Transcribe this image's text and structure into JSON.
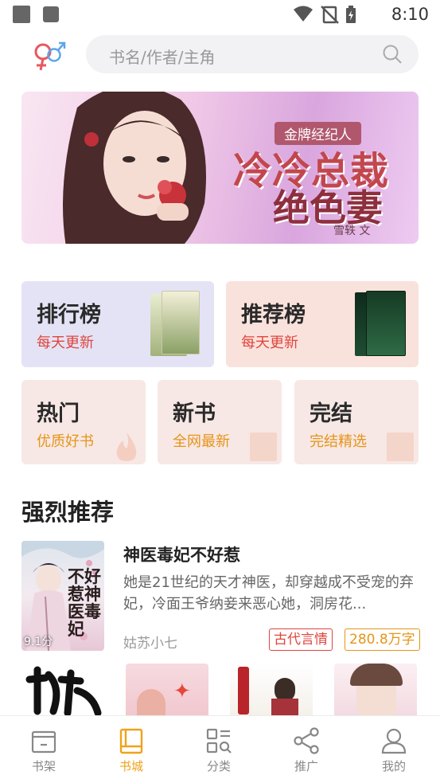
{
  "status_bar": {
    "time": "8:10"
  },
  "search": {
    "placeholder": "书名/作者/主角"
  },
  "banner": {
    "tag": "金牌经纪人",
    "title_line1": "冷冷总裁",
    "title_line2": "绝色妻",
    "author": "雪轶 文"
  },
  "rank_cards": [
    {
      "title": "排行榜",
      "subtitle": "每天更新"
    },
    {
      "title": "推荐榜",
      "subtitle": "每天更新"
    }
  ],
  "category_cards": [
    {
      "title": "热门",
      "subtitle": "优质好书"
    },
    {
      "title": "新书",
      "subtitle": "全网最新"
    },
    {
      "title": "完结",
      "subtitle": "完结精选"
    }
  ],
  "section": {
    "title": "强烈推荐"
  },
  "recommended": {
    "cover_text": "不好惹神医毒妃",
    "score": "9.1分",
    "title": "神医毒妃不好惹",
    "description": "她是21世纪的天才神医，却穿越成不受宠的弃妃，冷面王爷纳妾来恶心她，洞房花...",
    "author": "姑苏小七",
    "genre": "古代言情",
    "word_count": "280.8万字"
  },
  "bottom_nav": [
    {
      "label": "书架",
      "icon": "bookshelf-icon",
      "active": false
    },
    {
      "label": "书城",
      "icon": "bookstore-icon",
      "active": true
    },
    {
      "label": "分类",
      "icon": "category-icon",
      "active": false
    },
    {
      "label": "推广",
      "icon": "share-icon",
      "active": false
    },
    {
      "label": "我的",
      "icon": "profile-icon",
      "active": false
    }
  ],
  "colors": {
    "accent": "#f0a21b",
    "red_text": "#e0453c",
    "orange_text": "#e69418",
    "card_rank_bg": "#e4e3f6",
    "card_recommend_bg": "#fae2dc",
    "card_small_bg": "#f7e8e5"
  }
}
